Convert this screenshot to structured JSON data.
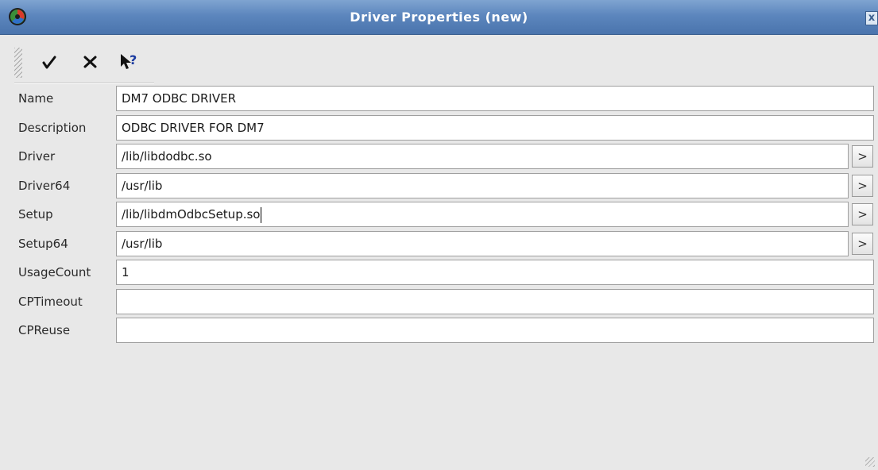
{
  "window": {
    "title": "Driver Properties (new)",
    "close_label": "x",
    "app_icon": "odbc-app-icon"
  },
  "toolbar": {
    "ok_icon": "checkmark-icon",
    "cancel_icon": "x-cross-icon",
    "help_icon": "whats-this-help-icon",
    "help_glyph": "?"
  },
  "fields": [
    {
      "label": "Name",
      "value": "DM7 ODBC DRIVER",
      "browse": false
    },
    {
      "label": "Description",
      "value": "ODBC DRIVER FOR DM7",
      "browse": false
    },
    {
      "label": "Driver",
      "value": "/lib/libdodbc.so",
      "browse": true
    },
    {
      "label": "Driver64",
      "value": "/usr/lib",
      "browse": true
    },
    {
      "label": "Setup",
      "value": "/lib/libdmOdbcSetup.so",
      "browse": true
    },
    {
      "label": "Setup64",
      "value": "/usr/lib",
      "browse": true
    },
    {
      "label": "UsageCount",
      "value": "1",
      "browse": false
    },
    {
      "label": "CPTimeout",
      "value": "",
      "browse": false
    },
    {
      "label": "CPReuse",
      "value": "",
      "browse": false
    }
  ],
  "browse_label": ">",
  "colors": {
    "titlebar": "#5c86bd",
    "background": "#e8e8e8",
    "input_border": "#9f9f9f"
  }
}
